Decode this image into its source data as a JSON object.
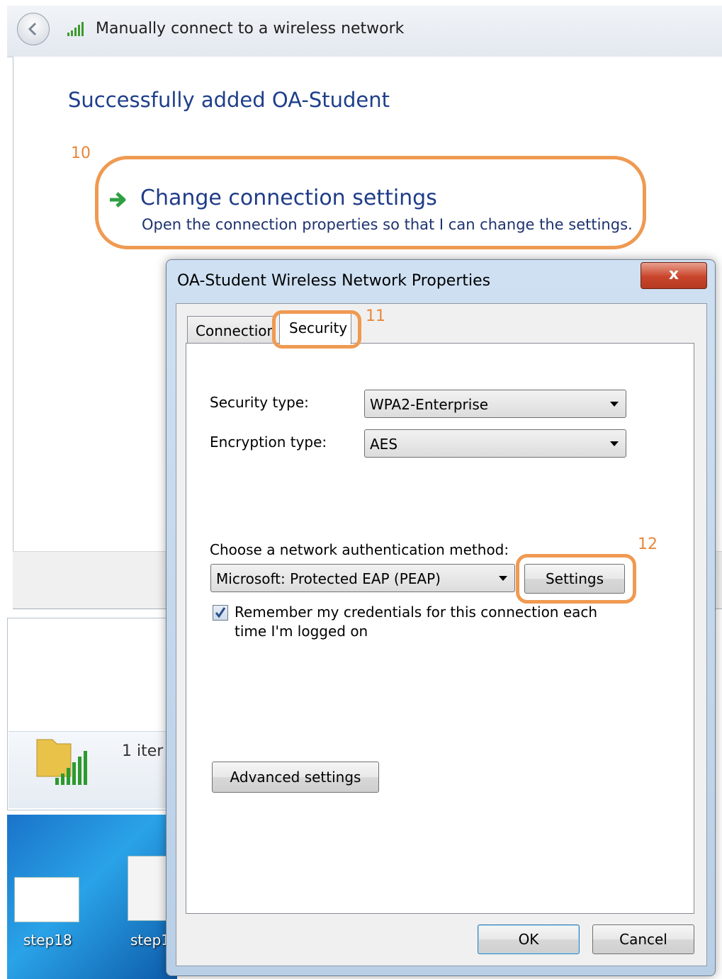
{
  "wizard": {
    "title": "Manually connect to a wireless network",
    "heading": "Successfully added OA-Student",
    "change_link": "Change connection settings",
    "change_desc": "Open the connection properties so that I can change the settings."
  },
  "annotations": {
    "step_10": "10",
    "step_11": "11",
    "step_12": "12"
  },
  "explorer": {
    "item_count": "1 iter"
  },
  "desktop": {
    "icon_1_label": "step18",
    "icon_2_label": "step1"
  },
  "dialog": {
    "title": "OA-Student Wireless Network Properties",
    "close_label": "x",
    "tabs": [
      {
        "label": "Connection"
      },
      {
        "label": "Security"
      }
    ],
    "security_type_label": "Security type:",
    "security_type_value": "WPA2-Enterprise",
    "encryption_type_label": "Encryption type:",
    "encryption_type_value": "AES",
    "auth_method_label": "Choose a network authentication method:",
    "auth_method_value": "Microsoft: Protected EAP (PEAP)",
    "settings_label": "Settings",
    "remember_line_1": "Remember my credentials for this connection each",
    "remember_line_2": "time I'm logged on",
    "remember_checked": true,
    "advanced_label": "Advanced settings",
    "ok_label": "OK",
    "cancel_label": "Cancel"
  },
  "colors": {
    "annotation": "#ef9a52",
    "heading": "#1e3f8a",
    "link": "#1f3c88",
    "close": "#c9452b"
  }
}
